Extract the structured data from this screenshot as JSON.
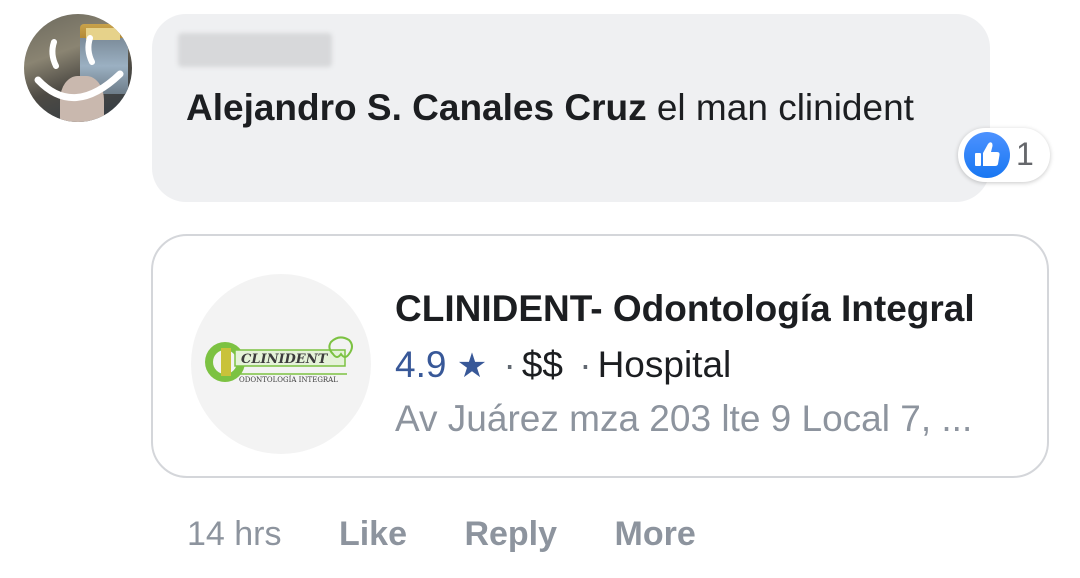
{
  "comment": {
    "author": "Alejandro S. Canales Cruz",
    "text": " el man clinident",
    "reaction_count": "1",
    "reaction_icon": "thumbs-up-icon",
    "reaction_color": "#1877f2"
  },
  "place_card": {
    "title": "CLINIDENT- Odontología Integral",
    "rating": "4.9",
    "star": "★",
    "separator": "·",
    "price": "$$",
    "category": "Hospital",
    "address": "Av Juárez mza 203 lte 9 Local 7, ...",
    "logo_text": "CLINIDENT",
    "logo_subtext": "ODONTOLOGÍA INTEGRAL",
    "logo_color": "#7cc242"
  },
  "actions": {
    "time": "14 hrs",
    "like": "Like",
    "reply": "Reply",
    "more": "More"
  }
}
